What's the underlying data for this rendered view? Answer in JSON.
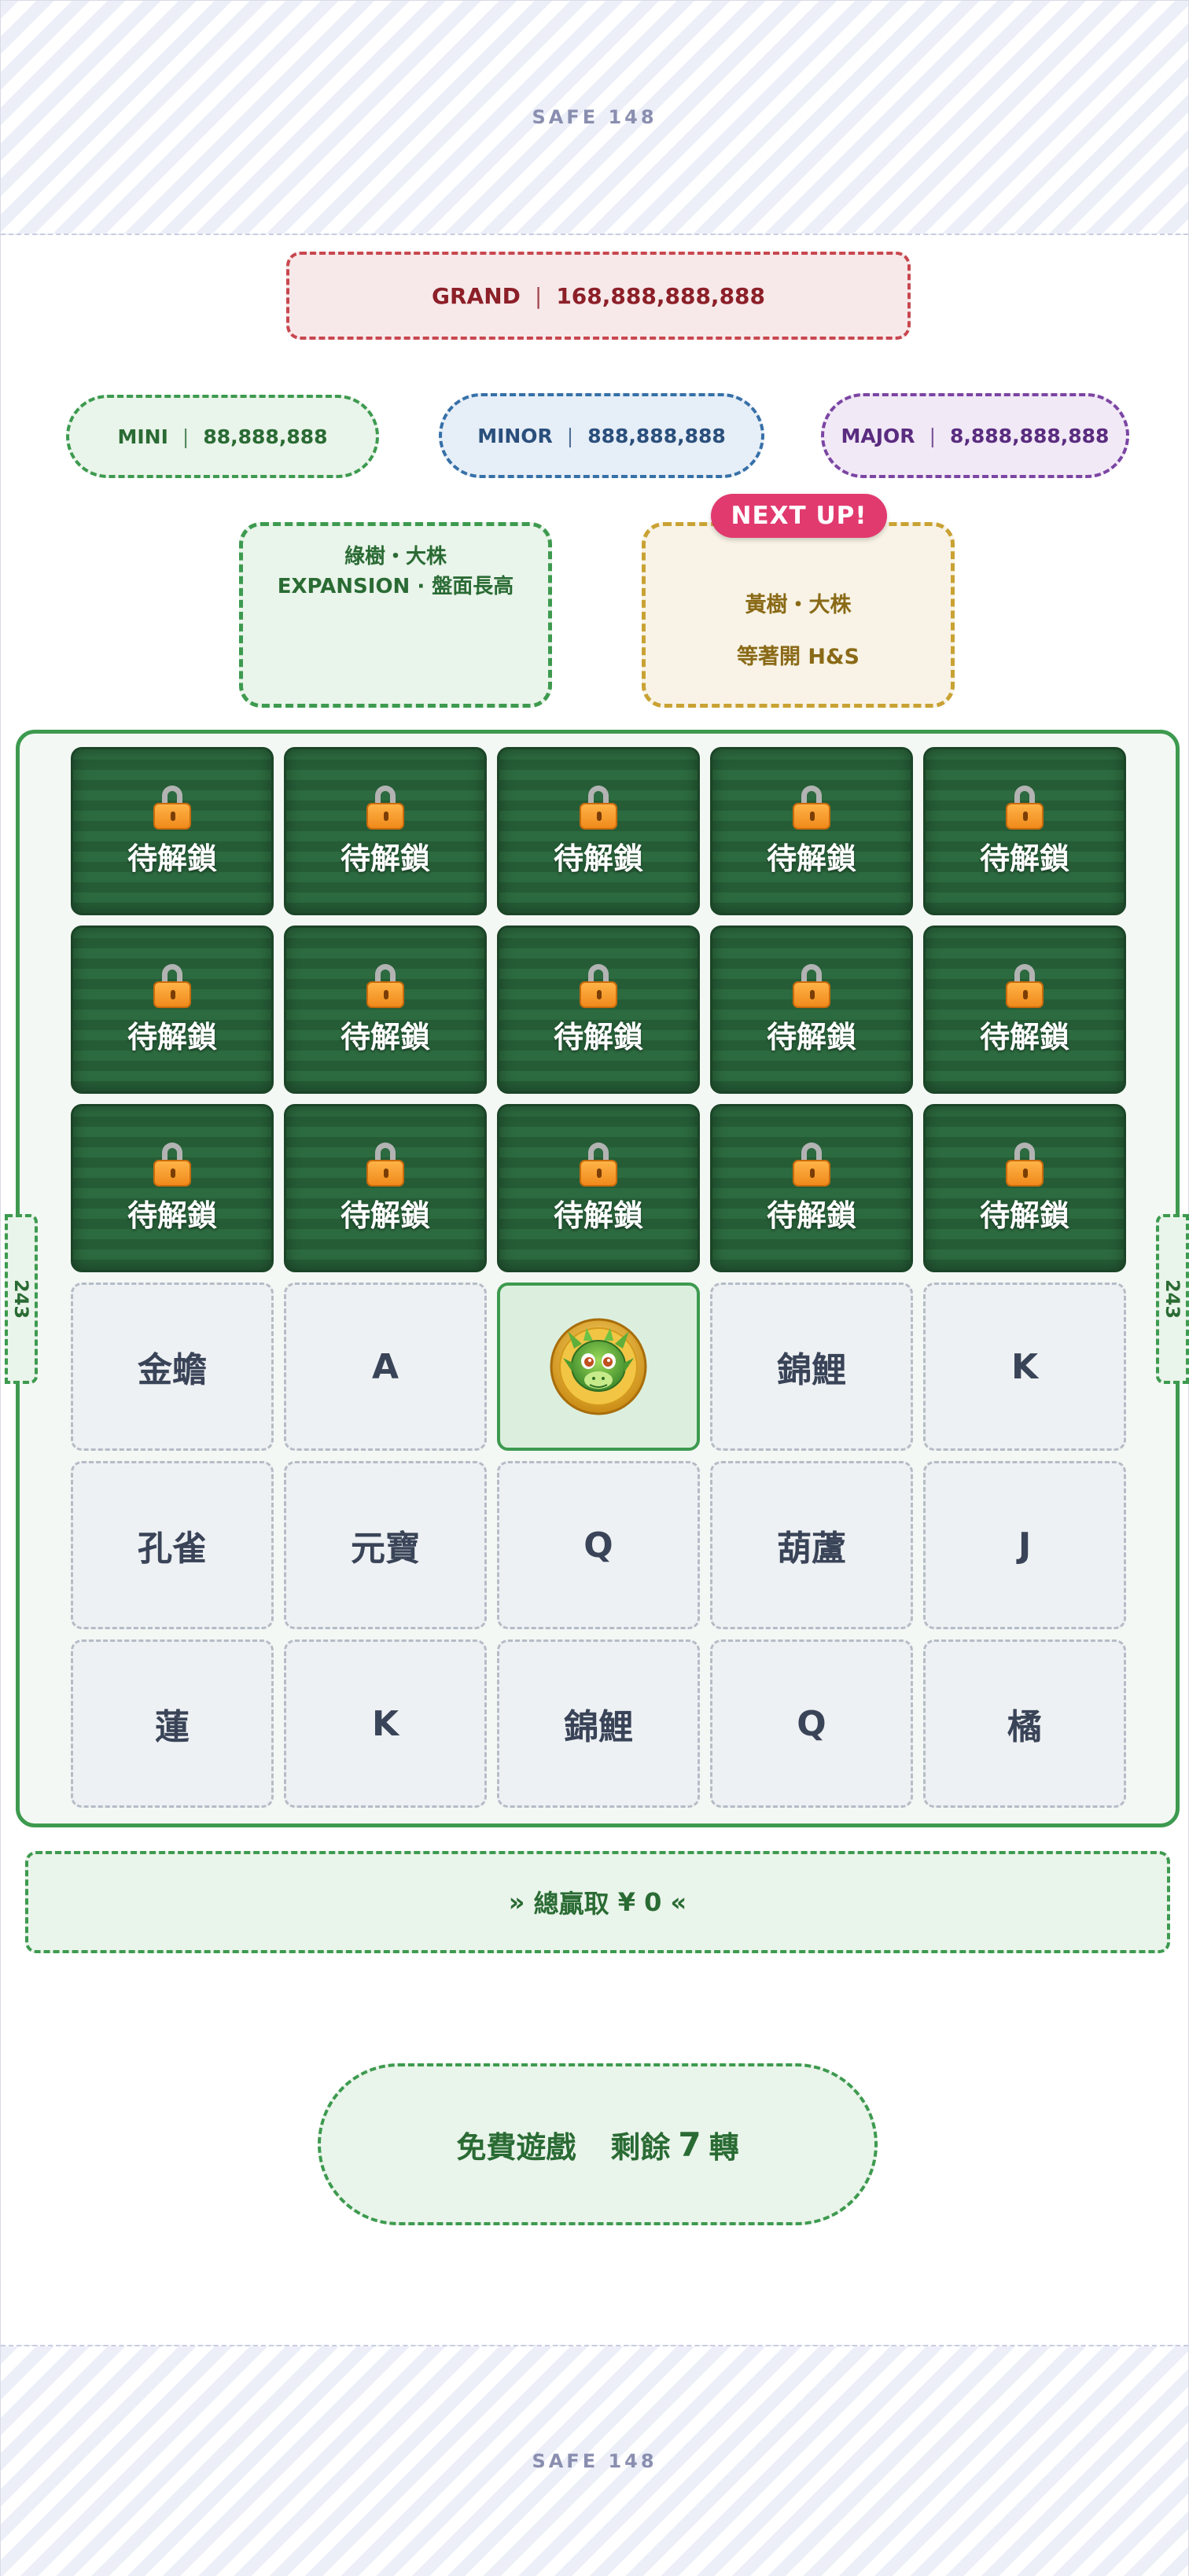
{
  "safe_zone": {
    "top_label": "SAFE 148",
    "bottom_label": "SAFE 148"
  },
  "jackpots": {
    "grand": {
      "name": "GRAND",
      "value": "168,888,888,888",
      "color": "#c8474f"
    },
    "mini": {
      "name": "MINI",
      "value": "88,888,888",
      "color": "#3d9a4f"
    },
    "minor": {
      "name": "MINOR",
      "value": "888,888,888",
      "color": "#3670a8"
    },
    "major": {
      "name": "MAJOR",
      "value": "8,888,888,888",
      "color": "#7b45a3"
    },
    "separator": "|"
  },
  "features": {
    "current": {
      "line1": "綠樹・大株",
      "line2": "EXPANSION · 盤面長高",
      "color": "#3d9a4f"
    },
    "next": {
      "badge": "NEXT UP!",
      "line1": "黃樹・大株",
      "line2": "等著開 H&S",
      "color": "#c9a234",
      "badge_color": "#e13a6f"
    }
  },
  "ways": {
    "left": "243",
    "right": "243"
  },
  "reels": {
    "locked_label": "待解鎖",
    "locked_icon": "padlock-icon",
    "rows": [
      [
        {
          "state": "locked"
        },
        {
          "state": "locked"
        },
        {
          "state": "locked"
        },
        {
          "state": "locked"
        },
        {
          "state": "locked"
        }
      ],
      [
        {
          "state": "locked"
        },
        {
          "state": "locked"
        },
        {
          "state": "locked"
        },
        {
          "state": "locked"
        },
        {
          "state": "locked"
        }
      ],
      [
        {
          "state": "locked"
        },
        {
          "state": "locked"
        },
        {
          "state": "locked"
        },
        {
          "state": "locked"
        },
        {
          "state": "locked"
        }
      ],
      [
        {
          "state": "open",
          "symbol": "金蟾"
        },
        {
          "state": "open",
          "symbol": "A"
        },
        {
          "state": "wild",
          "icon": "dragon-coin-icon"
        },
        {
          "state": "open",
          "symbol": "錦鯉"
        },
        {
          "state": "open",
          "symbol": "K"
        }
      ],
      [
        {
          "state": "open",
          "symbol": "孔雀"
        },
        {
          "state": "open",
          "symbol": "元寶"
        },
        {
          "state": "open",
          "symbol": "Q"
        },
        {
          "state": "open",
          "symbol": "葫蘆"
        },
        {
          "state": "open",
          "symbol": "J"
        }
      ],
      [
        {
          "state": "open",
          "symbol": "蓮"
        },
        {
          "state": "open",
          "symbol": "K"
        },
        {
          "state": "open",
          "symbol": "錦鯉"
        },
        {
          "state": "open",
          "symbol": "Q"
        },
        {
          "state": "open",
          "symbol": "橘"
        }
      ]
    ]
  },
  "total_win": {
    "prefix": "»",
    "label": "總贏取",
    "currency": "¥",
    "amount": "0",
    "suffix": "«"
  },
  "free_games": {
    "label": "免費遊戲",
    "remaining_label": "剩餘",
    "count": "7",
    "unit": "轉"
  }
}
